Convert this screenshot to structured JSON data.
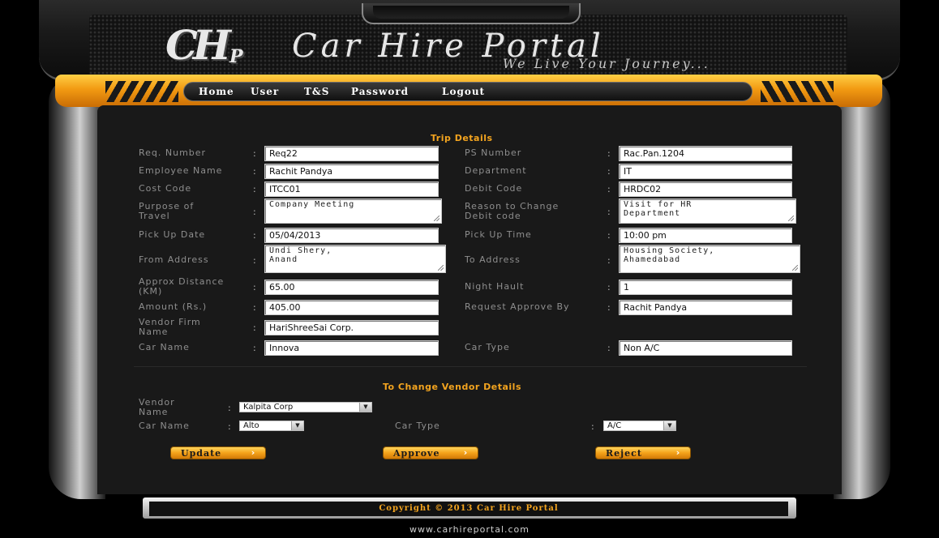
{
  "header": {
    "logo_mono": "CH",
    "logo_mono_p": "P",
    "title": "Car Hire Portal",
    "tagline": "We Live Your Journey..."
  },
  "nav": {
    "home": "Home",
    "user": "User",
    "ts": "T&S",
    "password": "Password",
    "logout": "Logout"
  },
  "trip": {
    "section_title": "Trip Details",
    "colon": ":",
    "req_number": {
      "label": "Req. Number",
      "value": "Req22"
    },
    "ps_number": {
      "label": "PS Number",
      "value": "Rac.Pan.1204"
    },
    "employee_name": {
      "label": "Employee Name",
      "value": "Rachit Pandya"
    },
    "department": {
      "label": "Department",
      "value": "IT"
    },
    "cost_code": {
      "label": "Cost Code",
      "value": "ITCC01"
    },
    "debit_code": {
      "label": "Debit Code",
      "value": "HRDC02"
    },
    "purpose": {
      "label_1": "Purpose of",
      "label_2": "Travel",
      "value": "Company Meeting"
    },
    "reason": {
      "label_1": "Reason to Change",
      "label_2": "Debit code",
      "value_1": "Visit for HR",
      "value_2": "Department"
    },
    "pickup_date": {
      "label": "Pick Up Date",
      "value": "05/04/2013"
    },
    "pickup_time": {
      "label": "Pick Up Time",
      "value": "10:00 pm"
    },
    "from_address": {
      "label": "From Address",
      "value_1": "Undi Shery,",
      "value_2": "Anand"
    },
    "to_address": {
      "label": "To Address",
      "value_1": "Housing Society,",
      "value_2": "Ahamedabad"
    },
    "approx_distance": {
      "label_1": "Approx Distance",
      "label_2": "(KM)",
      "value": "65.00"
    },
    "night_halt": {
      "label": "Night Hault",
      "value": "1"
    },
    "amount": {
      "label": "Amount (Rs.)",
      "value": "405.00"
    },
    "request_approve_by": {
      "label": "Request Approve By",
      "value": "Rachit Pandya"
    },
    "vendor_firm": {
      "label_1": "Vendor Firm",
      "label_2": "Name",
      "value": "HariShreeSai Corp."
    },
    "car_name": {
      "label": "Car Name",
      "value": "Innova"
    },
    "car_type": {
      "label": "Car Type",
      "value": "Non A/C"
    }
  },
  "vendor_change": {
    "section_title": "To Change Vendor Details",
    "vendor_name": {
      "label_1": "Vendor",
      "label_2": "Name",
      "selected": "Kalpita Corp"
    },
    "car_name": {
      "label": "Car Name",
      "selected": "Alto"
    },
    "car_type": {
      "label": "Car Type",
      "selected": "A/C"
    }
  },
  "buttons": {
    "update": "Update",
    "approve": "Approve",
    "reject": "Reject",
    "arrow": "›"
  },
  "footer": {
    "copyright": "Copyright © 2013 Car Hire Portal",
    "url": "www.carhireportal.com"
  },
  "colors": {
    "accent": "#f3a41f",
    "panel": "#191919",
    "background": "#000000"
  }
}
